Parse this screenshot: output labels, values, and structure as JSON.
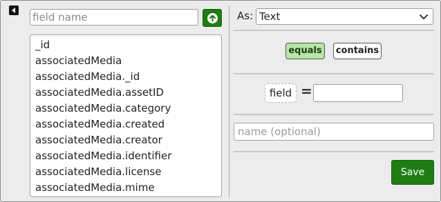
{
  "colors": {
    "accent_green": "#1f7d13",
    "equals_active_bg": "#b7e6a6",
    "panel_bg": "#ececec"
  },
  "toolbar": {
    "back_icon": "caret-left-icon",
    "field_search": {
      "value": "",
      "placeholder": "field name"
    },
    "up_icon": "arrow-up-circle-icon"
  },
  "field_list": {
    "items": [
      "_id",
      "associatedMedia",
      "associatedMedia._id",
      "associatedMedia.assetID",
      "associatedMedia.category",
      "associatedMedia.created",
      "associatedMedia.creator",
      "associatedMedia.identifier",
      "associatedMedia.license",
      "associatedMedia.mime"
    ]
  },
  "type_select": {
    "label": "As:",
    "selected": "Text",
    "icon": "chevron-down-icon"
  },
  "operators": {
    "equals_label": "equals",
    "contains_label": "contains",
    "selected": "equals"
  },
  "condition": {
    "field_label": "field",
    "operator_symbol": "=",
    "value": ""
  },
  "name_field": {
    "value": "",
    "placeholder": "name (optional)"
  },
  "actions": {
    "save_label": "Save"
  }
}
